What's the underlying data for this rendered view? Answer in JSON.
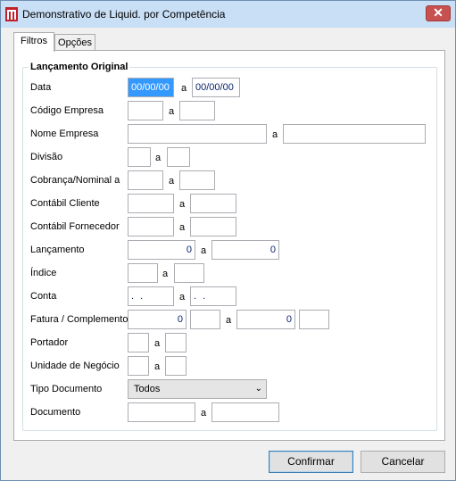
{
  "window": {
    "title": "Demonstrativo de  Liquid. por Competência",
    "close": "✕"
  },
  "tabs": [
    {
      "label": "Filtros"
    },
    {
      "label": "Opções"
    }
  ],
  "group": {
    "title": "Lançamento Original"
  },
  "fields": {
    "data": {
      "label": "Data",
      "from": "00/00/00",
      "sep": "a",
      "to": "00/00/00"
    },
    "codigo_empresa": {
      "label": "Código Empresa",
      "sep": "a"
    },
    "nome_empresa": {
      "label": "Nome Empresa",
      "sep": "a"
    },
    "divisao": {
      "label": "Divisão",
      "sep": "a"
    },
    "cobranca": {
      "label": "Cobrança/Nominal a",
      "sep": "a"
    },
    "contabil_cliente": {
      "label": "Contábil Cliente",
      "sep": "a"
    },
    "contabil_fornecedor": {
      "label": "Contábil Fornecedor",
      "sep": "a"
    },
    "lancamento": {
      "label": "Lançamento",
      "from": "0",
      "sep": "a",
      "to": "0"
    },
    "indice": {
      "label": "Índice",
      "sep": "a"
    },
    "conta": {
      "label": "Conta",
      "from": ". .",
      "sep": "a",
      "to": ". ."
    },
    "fatura": {
      "label": "Fatura / Complemento",
      "from": "0",
      "sep": "a",
      "to": "0"
    },
    "portador": {
      "label": "Portador",
      "sep": "a"
    },
    "unidade_negocio": {
      "label": "Unidade de Negócio",
      "sep": "a"
    },
    "tipo_documento": {
      "label": "Tipo Documento",
      "value": "Todos"
    },
    "documento": {
      "label": "Documento",
      "sep": "a"
    }
  },
  "buttons": {
    "confirm": "Confirmar",
    "cancel": "Cancelar"
  }
}
